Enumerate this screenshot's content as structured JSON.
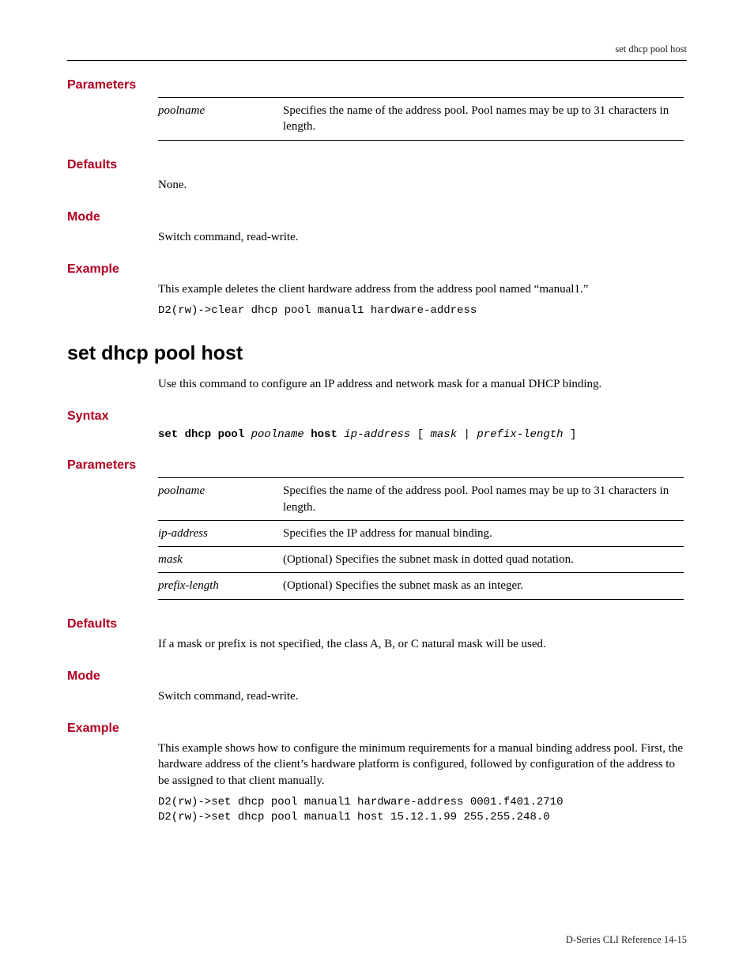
{
  "header": {
    "running": "set dhcp pool host"
  },
  "footer": {
    "text": "D-Series CLI Reference    14-15"
  },
  "s1": {
    "parameters_label": "Parameters",
    "params": [
      {
        "term": "poolname",
        "desc": "Specifies the name of the address pool. Pool names may be up to 31 characters in length."
      }
    ],
    "defaults_label": "Defaults",
    "defaults_text": "None.",
    "mode_label": "Mode",
    "mode_text": "Switch command, read-write.",
    "example_label": "Example",
    "example_text": "This example deletes the client hardware address from the address pool named “manual1.”",
    "example_code": "D2(rw)->clear dhcp pool manual1 hardware-address"
  },
  "s2": {
    "title": "set dhcp pool host",
    "intro": "Use this command to configure an IP address and network mask for a manual DHCP binding.",
    "syntax_label": "Syntax",
    "syntax": {
      "kw1": "set dhcp pool",
      "arg1": "poolname",
      "kw2": "host",
      "arg2": "ip-address",
      "opt_open": " [",
      "opt_arg1": "mask",
      "opt_sep": " | ",
      "opt_arg2": "prefix-length",
      "opt_close": "]"
    },
    "parameters_label": "Parameters",
    "params": [
      {
        "term": "poolname",
        "desc": "Specifies the name of the address pool. Pool names may be up to 31 characters in length."
      },
      {
        "term": "ip-address",
        "desc": "Specifies the IP address for manual binding."
      },
      {
        "term": "mask",
        "desc": "(Optional) Specifies the subnet mask in dotted quad notation."
      },
      {
        "term": "prefix-length",
        "desc": "(Optional) Specifies the subnet mask as an integer."
      }
    ],
    "defaults_label": "Defaults",
    "defaults_text": "If a mask or prefix is not specified, the class A, B, or C natural mask will be used.",
    "mode_label": "Mode",
    "mode_text": "Switch command, read-write.",
    "example_label": "Example",
    "example_text": "This example shows how to configure the minimum requirements for a manual binding address pool. First, the hardware address of the client’s hardware platform is configured, followed by configuration of the address to be assigned to that client manually.",
    "example_code": "D2(rw)->set dhcp pool manual1 hardware-address 0001.f401.2710\nD2(rw)->set dhcp pool manual1 host 15.12.1.99 255.255.248.0"
  }
}
